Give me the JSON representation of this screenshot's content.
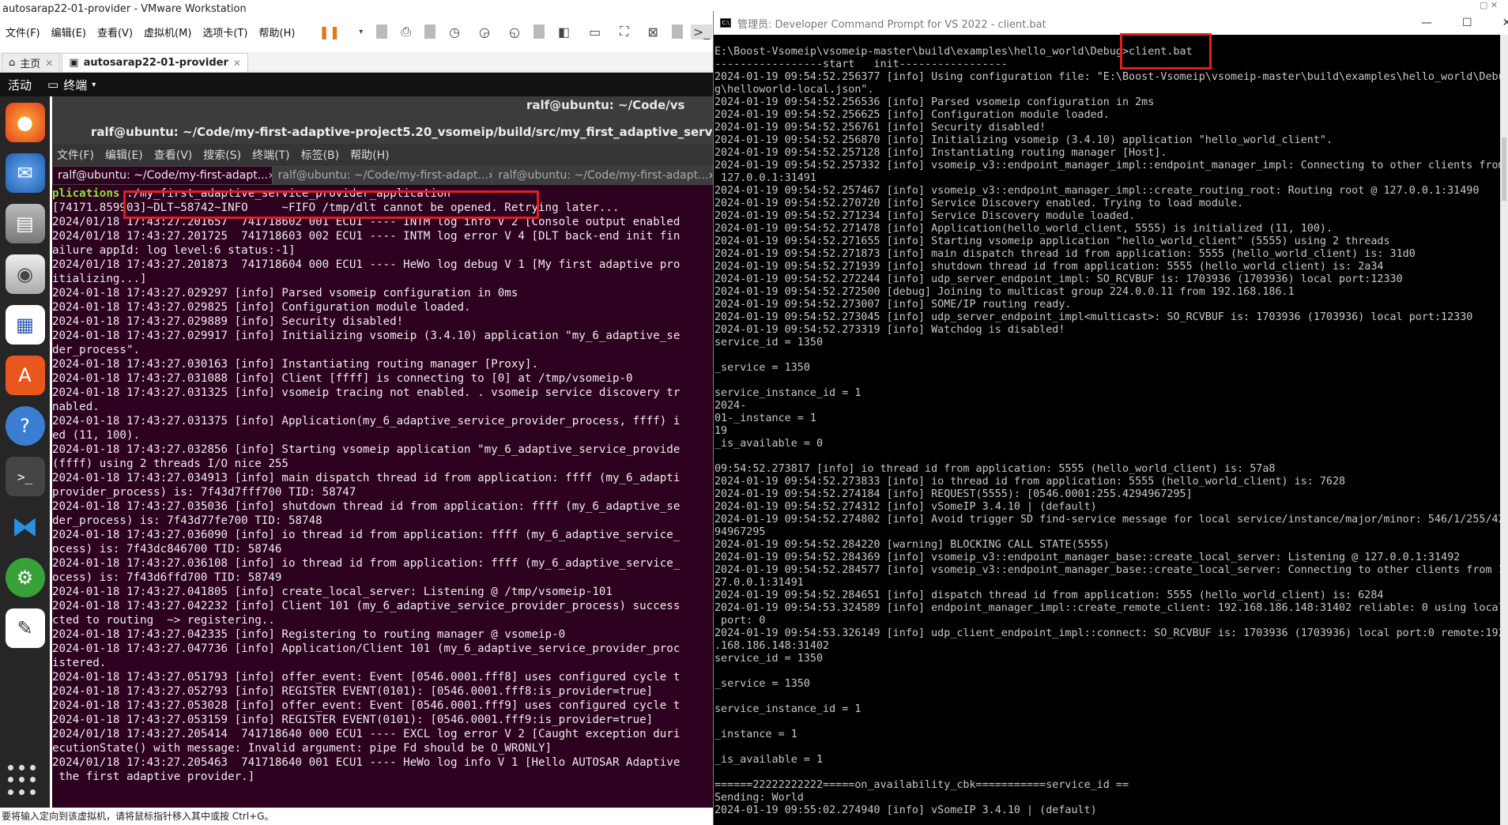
{
  "vmware": {
    "title": "autosarap22-01-provider - VMware Workstation",
    "menu": [
      "文件(F)",
      "编辑(E)",
      "查看(V)",
      "虚拟机(M)",
      "选项卡(T)",
      "帮助(H)"
    ],
    "tabs": [
      {
        "label": "主页",
        "icon": "home-icon"
      },
      {
        "label": "autosarap22-01-provider",
        "icon": "vm-icon"
      }
    ],
    "status": "要将输入定向到该虚拟机，请将鼠标指针移入其中或按 Ctrl+G。"
  },
  "gnome": {
    "activities": "活动",
    "app_name": "终端",
    "terminal_window_title_top": "ralf@ubuntu: ~/Code/vs",
    "terminal_window_title": "ralf@ubuntu: ~/Code/my-first-adaptive-project5.20_vsomeip/build/src/my_first_adaptive_service_provider_app",
    "terminal_menu": [
      "文件(F)",
      "编辑(E)",
      "查看(V)",
      "搜索(S)",
      "终端(T)",
      "标签(B)",
      "帮助(H)"
    ],
    "terminal_tabs": [
      "ralf@ubuntu: ~/Code/my-first-adapt...",
      "ralf@ubuntu: ~/Code/my-first-adapt...",
      "ralf@ubuntu: ~/Code/my-first-adapt..."
    ],
    "dock": [
      "firefox-icon",
      "thunderbird-icon",
      "files-icon",
      "rhythmbox-icon",
      "writer-icon",
      "software-icon",
      "help-icon",
      "terminal-icon",
      "vscode-icon",
      "gear-app-icon",
      "text-editor-icon"
    ]
  },
  "terminal": {
    "prompt_prefix": "plications",
    "command": " ./my_first_adaptive_service_provider_application",
    "lines": [
      "[74171.859903]~DLT~58742~INFO     ~FIFO /tmp/dlt cannot be opened. Retrying later...",
      "2024/01/18 17:43:27.201657  741718602 001 ECU1 ---- INTM log info V 2 [Console output enabled",
      "2024/01/18 17:43:27.201725  741718603 002 ECU1 ---- INTM log error V 4 [DLT back-end init fin",
      "ailure appId: log level:6 status:-1]",
      "2024/01/18 17:43:27.201873  741718604 000 ECU1 ---- HeWo log debug V 1 [My first adaptive pro",
      "itializing...]",
      "2024-01-18 17:43:27.029297 [info] Parsed vsomeip configuration in 0ms",
      "2024-01-18 17:43:27.029825 [info] Configuration module loaded.",
      "2024-01-18 17:43:27.029889 [info] Security disabled!",
      "2024-01-18 17:43:27.029917 [info] Initializing vsomeip (3.4.10) application \"my_6_adaptive_se",
      "der_process\".",
      "2024-01-18 17:43:27.030163 [info] Instantiating routing manager [Proxy].",
      "2024-01-18 17:43:27.031088 [info] Client [ffff] is connecting to [0] at /tmp/vsomeip-0",
      "2024-01-18 17:43:27.031325 [info] vsomeip tracing not enabled. . vsomeip service discovery tr",
      "nabled.",
      "2024-01-18 17:43:27.031375 [info] Application(my_6_adaptive_service_provider_process, ffff) i",
      "ed (11, 100).",
      "2024-01-18 17:43:27.032856 [info] Starting vsomeip application \"my_6_adaptive_service_provide",
      "(ffff) using 2 threads I/O nice 255",
      "2024-01-18 17:43:27.034913 [info] main dispatch thread id from application: ffff (my_6_adapti",
      "provider_process) is: 7f43d7fff700 TID: 58747",
      "2024-01-18 17:43:27.035036 [info] shutdown thread id from application: ffff (my_6_adaptive_se",
      "der_process) is: 7f43d77fe700 TID: 58748",
      "2024-01-18 17:43:27.036090 [info] io thread id from application: ffff (my_6_adaptive_service_",
      "ocess) is: 7f43dc846700 TID: 58746",
      "2024-01-18 17:43:27.036108 [info] io thread id from application: ffff (my_6_adaptive_service_",
      "ocess) is: 7f43d6ffd700 TID: 58749",
      "2024-01-18 17:43:27.041805 [info] create_local_server: Listening @ /tmp/vsomeip-101",
      "2024-01-18 17:43:27.042232 [info] Client 101 (my_6_adaptive_service_provider_process) success",
      "cted to routing  ~> registering..",
      "2024-01-18 17:43:27.042335 [info] Registering to routing manager @ vsomeip-0",
      "2024-01-18 17:43:27.047736 [info] Application/Client 101 (my_6_adaptive_service_provider_proc",
      "istered.",
      "2024-01-18 17:43:27.051793 [info] offer_event: Event [0546.0001.fff8] uses configured cycle t",
      "2024-01-18 17:43:27.052793 [info] REGISTER EVENT(0101): [0546.0001.fff8:is_provider=true]",
      "2024-01-18 17:43:27.053028 [info] offer_event: Event [0546.0001.fff9] uses configured cycle t",
      "2024-01-18 17:43:27.053159 [info] REGISTER EVENT(0101): [0546.0001.fff9:is_provider=true]",
      "2024/01/18 17:43:27.205414  741718640 000 ECU1 ---- EXCL log error V 2 [Caught exception duri",
      "ecutionState() with message: Invalid argument: pipe Fd should be O_WRONLY]",
      "2024/01/18 17:43:27.205463  741718640 001 ECU1 ---- HeWo log info V 1 [Hello AUTOSAR Adaptive",
      " the first adaptive provider.]"
    ]
  },
  "cmd": {
    "title": "管理员: Developer Command Prompt for VS 2022 - client.bat",
    "prompt": "E:\\Boost-Vsomeip\\vsomeip-master\\build\\examples\\hello_world\\Debug>",
    "command": "client.bat",
    "lines": [
      "-----------------start   init-----------------",
      "2024-01-19 09:54:52.256377 [info] Using configuration file: \"E:\\Boost-Vsomeip\\vsomeip-master\\build\\examples\\hello_world\\Debu",
      "g\\helloworld-local.json\".",
      "2024-01-19 09:54:52.256536 [info] Parsed vsomeip configuration in 2ms",
      "2024-01-19 09:54:52.256625 [info] Configuration module loaded.",
      "2024-01-19 09:54:52.256761 [info] Security disabled!",
      "2024-01-19 09:54:52.256870 [info] Initializing vsomeip (3.4.10) application \"hello_world_client\".",
      "2024-01-19 09:54:52.257128 [info] Instantiating routing manager [Host].",
      "2024-01-19 09:54:52.257332 [info] vsomeip_v3::endpoint_manager_impl::endpoint_manager_impl: Connecting to other clients from",
      " 127.0.0.1:31491",
      "2024-01-19 09:54:52.257467 [info] vsomeip_v3::endpoint_manager_impl::create_routing_root: Routing root @ 127.0.0.1:31490",
      "2024-01-19 09:54:52.270720 [info] Service Discovery enabled. Trying to load module.",
      "2024-01-19 09:54:52.271234 [info] Service Discovery module loaded.",
      "2024-01-19 09:54:52.271478 [info] Application(hello_world_client, 5555) is initialized (11, 100).",
      "2024-01-19 09:54:52.271655 [info] Starting vsomeip application \"hello_world_client\" (5555) using 2 threads",
      "2024-01-19 09:54:52.271873 [info] main dispatch thread id from application: 5555 (hello_world_client) is: 31d0",
      "2024-01-19 09:54:52.271939 [info] shutdown thread id from application: 5555 (hello_world_client) is: 2a34",
      "2024-01-19 09:54:52.272244 [info] udp_server_endpoint_impl: SO_RCVBUF is: 1703936 (1703936) local port:12330",
      "2024-01-19 09:54:52.272500 [debug] Joining to multicast group 224.0.0.11 from 192.168.186.1",
      "2024-01-19 09:54:52.273007 [info] SOME/IP routing ready.",
      "2024-01-19 09:54:52.273045 [info] udp_server_endpoint_impl<multicast>: SO_RCVBUF is: 1703936 (1703936) local port:12330",
      "2024-01-19 09:54:52.273319 [info] Watchdog is disabled!",
      "service_id = 1350",
      "",
      "_service = 1350",
      "",
      "service_instance_id = 1",
      "2024-",
      "01-_instance = 1",
      "19",
      "_is_available = 0",
      "",
      "09:54:52.273817 [info] io thread id from application: 5555 (hello_world_client) is: 57a8",
      "2024-01-19 09:54:52.273833 [info] io thread id from application: 5555 (hello_world_client) is: 7628",
      "2024-01-19 09:54:52.274184 [info] REQUEST(5555): [0546.0001:255.4294967295]",
      "2024-01-19 09:54:52.274312 [info] vSomeIP 3.4.10 | (default)",
      "2024-01-19 09:54:52.274802 [info] Avoid trigger SD find-service message for local service/instance/major/minor: 546/1/255/42",
      "94967295",
      "2024-01-19 09:54:52.284220 [warning] BLOCKING CALL STATE(5555)",
      "2024-01-19 09:54:52.284369 [info] vsomeip_v3::endpoint_manager_base::create_local_server: Listening @ 127.0.0.1:31492",
      "2024-01-19 09:54:52.284577 [info] vsomeip_v3::endpoint_manager_base::create_local_server: Connecting to other clients from 1",
      "27.0.0.1:31491",
      "2024-01-19 09:54:52.284651 [info] dispatch thread id from application: 5555 (hello_world_client) is: 6284",
      "2024-01-19 09:54:53.324589 [info] endpoint_manager_impl::create_remote_client: 192.168.186.148:31402 reliable: 0 using local",
      " port: 0",
      "2024-01-19 09:54:53.326149 [info] udp_client_endpoint_impl::connect: SO_RCVBUF is: 1703936 (1703936) local port:0 remote:192",
      ".168.186.148:31402",
      "service_id = 1350",
      "",
      "_service = 1350",
      "",
      "service_instance_id = 1",
      "",
      "_instance = 1",
      "",
      "_is_available = 1",
      "",
      "======22222222222=====on_availability_cbk===========service_id ==",
      "Sending: World",
      "2024-01-19 09:55:02.274940 [info] vSomeIP 3.4.10 | (default)"
    ]
  }
}
